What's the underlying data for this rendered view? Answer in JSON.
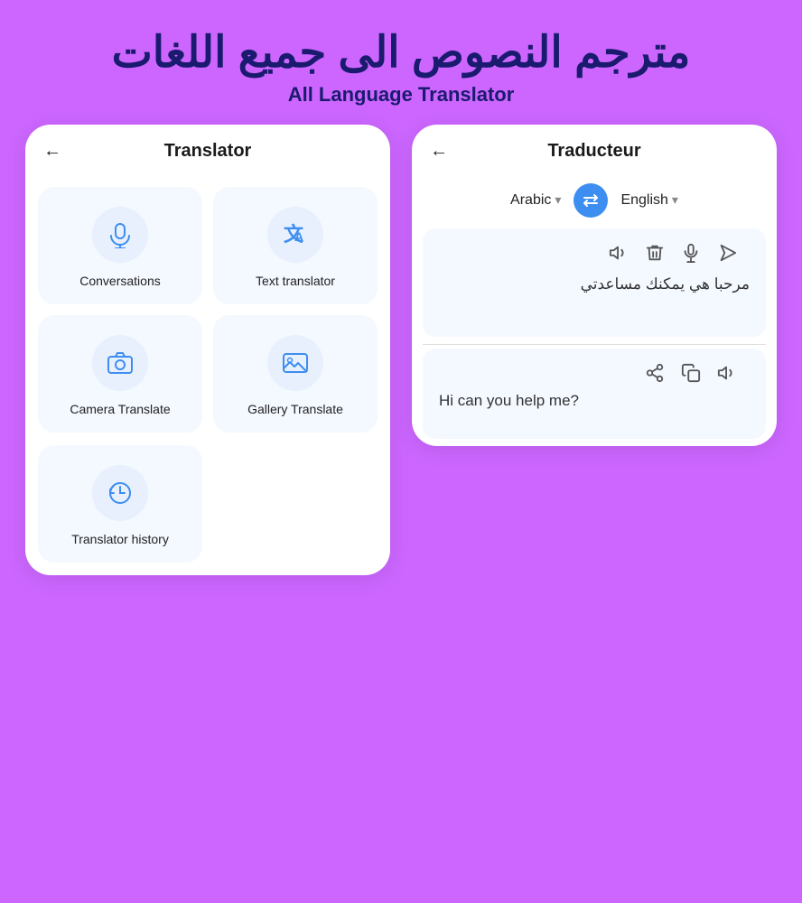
{
  "header": {
    "arabic_title": "مترجم النصوص الى جميع اللغات",
    "english_subtitle": "All Language Translator"
  },
  "left_card": {
    "title": "Translator",
    "back_arrow": "←",
    "menu_items": [
      {
        "id": "conversations",
        "label": "Conversations",
        "icon": "mic"
      },
      {
        "id": "text-translator",
        "label": "Text translator",
        "icon": "translate"
      },
      {
        "id": "camera-translate",
        "label": "Camera Translate",
        "icon": "camera"
      },
      {
        "id": "gallery-translate",
        "label": "Gallery Translate",
        "icon": "gallery"
      }
    ],
    "history_item": {
      "id": "translator-history",
      "label": "Translator history",
      "icon": "history"
    }
  },
  "right_card": {
    "title": "Traducteur",
    "back_arrow": "←",
    "source_lang": "Arabic",
    "target_lang": "English",
    "arabic_text": "مرحبا هي يمكنك مساعدتي",
    "translated_text": "Hi can you help me?",
    "icons": {
      "volume": "🔊",
      "delete": "🗑",
      "mic": "🎤",
      "send": "▶",
      "share": "⎆",
      "copy": "⧉",
      "volume2": "🔊"
    }
  }
}
